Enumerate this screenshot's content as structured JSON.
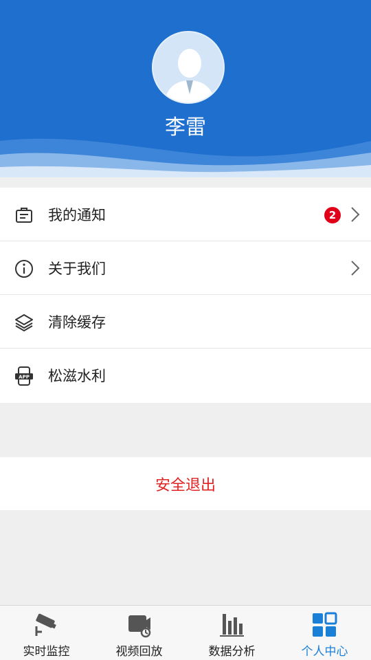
{
  "profile": {
    "name": "李雷",
    "avatar_icon": "user-avatar-icon"
  },
  "menu": {
    "items": [
      {
        "label": "我的通知",
        "icon": "notice-icon",
        "badge": "2",
        "has_arrow": true
      },
      {
        "label": "关于我们",
        "icon": "info-icon",
        "has_arrow": true
      },
      {
        "label": "清除缓存",
        "icon": "layers-icon",
        "has_arrow": false
      },
      {
        "label": "松滋水利",
        "icon": "app-icon",
        "has_arrow": false
      }
    ]
  },
  "logout": {
    "label": "安全退出"
  },
  "tabbar": {
    "tabs": [
      {
        "label": "实时监控",
        "icon": "camera-icon",
        "active": false
      },
      {
        "label": "视频回放",
        "icon": "video-playback-icon",
        "active": false
      },
      {
        "label": "数据分析",
        "icon": "bar-chart-icon",
        "active": false
      },
      {
        "label": "个人中心",
        "icon": "grid-icon",
        "active": true
      }
    ]
  },
  "colors": {
    "header": "#1f6fcf",
    "badge": "#e1001a",
    "logout": "#e02222",
    "active_tab": "#1a7fd6"
  }
}
